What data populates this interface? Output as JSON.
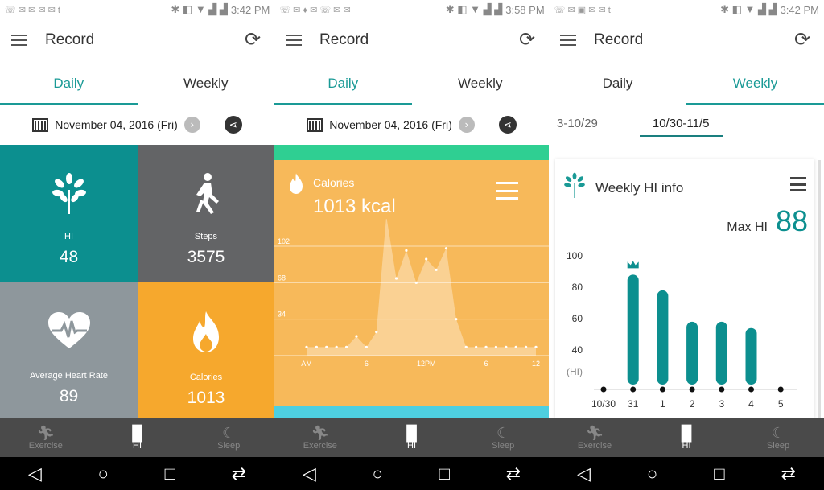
{
  "status": [
    {
      "time": "3:42 PM"
    },
    {
      "time": "3:58 PM"
    },
    {
      "time": "3:42 PM"
    }
  ],
  "appbar": {
    "title": "Record"
  },
  "tabs": {
    "daily": "Daily",
    "weekly": "Weekly"
  },
  "date": "November 04, 2016 (Fri)",
  "tiles": {
    "hi": {
      "label": "HI",
      "value": "48",
      "color": "#0c8f8f"
    },
    "steps": {
      "label": "Steps",
      "value": "3575",
      "color": "#636466"
    },
    "hr": {
      "label": "Average Heart Rate",
      "value": "89",
      "color": "#8e979c"
    },
    "calories": {
      "label": "Calories",
      "value": "1013",
      "color": "#f6a82d"
    }
  },
  "calories_card": {
    "title": "Calories",
    "value": "1013 kcal"
  },
  "weekly": {
    "prev_range": "3-10/29",
    "range": "10/30-11/5",
    "card_title": "Weekly HI info",
    "max_label": "Max HI",
    "max_value": "88"
  },
  "nav": {
    "exercise": "Exercise",
    "hi": "HI",
    "sleep": "Sleep"
  },
  "chart_data": [
    {
      "type": "area",
      "title": "Calories",
      "x_ticks": [
        "AM",
        "6",
        "12PM",
        "6",
        "12"
      ],
      "y_ticks": [
        34,
        68,
        102
      ],
      "x": [
        0,
        1,
        2,
        3,
        4,
        5,
        6,
        7,
        8,
        9,
        10,
        11,
        12,
        13,
        14,
        15,
        16,
        17,
        18,
        19,
        20,
        21,
        22,
        23
      ],
      "values": [
        8,
        8,
        8,
        8,
        8,
        18,
        8,
        22,
        130,
        72,
        98,
        68,
        90,
        80,
        100,
        34,
        8,
        8,
        8,
        8,
        8,
        8,
        8,
        8
      ],
      "ylim": [
        0,
        120
      ]
    },
    {
      "type": "bar",
      "ylabel": "(HI)",
      "y_ticks": [
        40,
        60,
        80,
        100
      ],
      "ylim": [
        20,
        100
      ],
      "categories": [
        "10/30",
        "31",
        "1",
        "2",
        "3",
        "4",
        "5"
      ],
      "values": [
        null,
        88,
        78,
        58,
        58,
        54,
        null
      ],
      "highlight": "31"
    }
  ]
}
